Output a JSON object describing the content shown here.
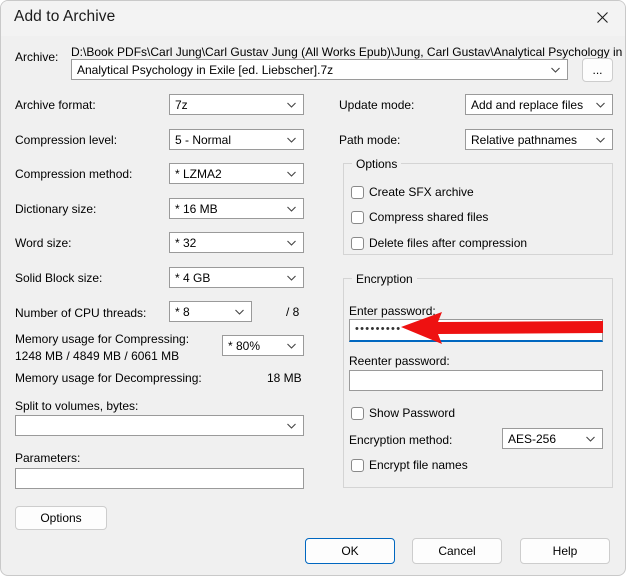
{
  "window": {
    "title": "Add to Archive",
    "close_icon": "close-icon"
  },
  "archive": {
    "label": "Archive:",
    "path_text": "D:\\Book PDFs\\Carl Jung\\Carl Gustav Jung (All Works Epub)\\Jung, Carl Gustav\\Analytical Psychology in Exile [ed.",
    "name_value": "Analytical Psychology in Exile [ed. Liebscher].7z",
    "browse_label": "..."
  },
  "left_column": {
    "archive_format": {
      "label": "Archive format:",
      "value": "7z"
    },
    "compression_level": {
      "label": "Compression level:",
      "value": "5 - Normal"
    },
    "compression_method": {
      "label": "Compression method:",
      "value": "*  LZMA2"
    },
    "dictionary_size": {
      "label": "Dictionary size:",
      "value": "*  16 MB"
    },
    "word_size": {
      "label": "Word size:",
      "value": "*  32"
    },
    "solid_block_size": {
      "label": "Solid Block size:",
      "value": "*  4 GB"
    },
    "cpu_threads": {
      "label": "Number of CPU threads:",
      "value": "*  8",
      "total": "/ 8"
    },
    "memory_compressing": {
      "label": "Memory usage for Compressing:",
      "values": "1248 MB / 4849 MB / 6061 MB",
      "percent": "*  80%"
    },
    "memory_decompressing": {
      "label": "Memory usage for Decompressing:",
      "value": "18 MB"
    },
    "split_volumes": {
      "label": "Split to volumes, bytes:",
      "value": ""
    },
    "parameters": {
      "label": "Parameters:",
      "value": ""
    },
    "options_button": "Options"
  },
  "right_column": {
    "update_mode": {
      "label": "Update mode:",
      "value": "Add and replace files"
    },
    "path_mode": {
      "label": "Path mode:",
      "value": "Relative pathnames"
    },
    "options_group": {
      "title": "Options",
      "checkboxes": [
        {
          "label": "Create SFX archive",
          "checked": false
        },
        {
          "label": "Compress shared files",
          "checked": false
        },
        {
          "label": "Delete files after compression",
          "checked": false
        }
      ]
    },
    "encryption_group": {
      "title": "Encryption",
      "enter_password_label": "Enter password:",
      "enter_password_value": "•••••••••",
      "reenter_password_label": "Reenter password:",
      "reenter_password_value": "",
      "show_password": {
        "label": "Show Password",
        "checked": false
      },
      "encryption_method": {
        "label": "Encryption method:",
        "value": "AES-256"
      },
      "encrypt_file_names": {
        "label": "Encrypt file names",
        "checked": false
      }
    }
  },
  "footer": {
    "ok": "OK",
    "cancel": "Cancel",
    "help": "Help"
  },
  "annotation": {
    "arrow_color": "#ee1111",
    "arrow_points_to": "enter-password-field"
  }
}
